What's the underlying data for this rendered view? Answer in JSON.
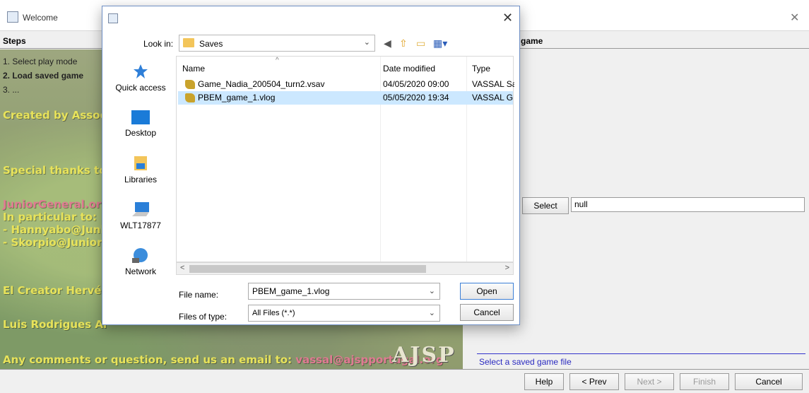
{
  "wizard": {
    "title": "Welcome",
    "close_glyph": "✕",
    "steps_title": "Steps",
    "steps": [
      "1. Select play mode",
      "2. Load saved game",
      "3. ..."
    ],
    "right_title": "Load saved game",
    "right_title_visible": "game",
    "select_button": "Select",
    "select_value": "null",
    "status": "Select a saved game file",
    "buttons": {
      "help": "Help",
      "prev": "< Prev",
      "next": "Next >",
      "finish": "Finish",
      "cancel": "Cancel"
    }
  },
  "art": {
    "lines": [
      "Created by Assoc",
      "Special thanks to",
      "JuniorGeneral.org",
      "In particular to:",
      "- Hannyabo@Juni",
      "- Skorpio@Junior",
      "El Creator Hervé",
      "Luis Rodrigues Al"
    ],
    "footer_text": "Any comments or question, send us an email to: ",
    "footer_email": "vassal@ajspportugal.org",
    "logo": "AJSP"
  },
  "dialog": {
    "close_glyph": "✕",
    "look_in_label": "Look in:",
    "look_in_value": "Saves",
    "places": [
      "Quick access",
      "Desktop",
      "Libraries",
      "WLT17877",
      "Network"
    ],
    "columns": {
      "name": "Name",
      "date": "Date modified",
      "type": "Type"
    },
    "files": [
      {
        "name": "Game_Nadia_200504_turn2.vsav",
        "date": "04/05/2020 09:00",
        "type": "VASSAL Sa",
        "selected": false
      },
      {
        "name": "PBEM_game_1.vlog",
        "date": "05/05/2020 19:34",
        "type": "VASSAL G",
        "selected": true
      }
    ],
    "file_name_label": "File name:",
    "file_name_value": "PBEM_game_1.vlog",
    "files_of_type_label": "Files of type:",
    "files_of_type_value": "All Files (*.*)",
    "open_button": "Open",
    "cancel_button": "Cancel"
  },
  "colors": {
    "selection": "#cce8ff",
    "status_text": "#2a2ac0",
    "art_text": "#e8e35a",
    "art_pink": "#e07a92"
  }
}
